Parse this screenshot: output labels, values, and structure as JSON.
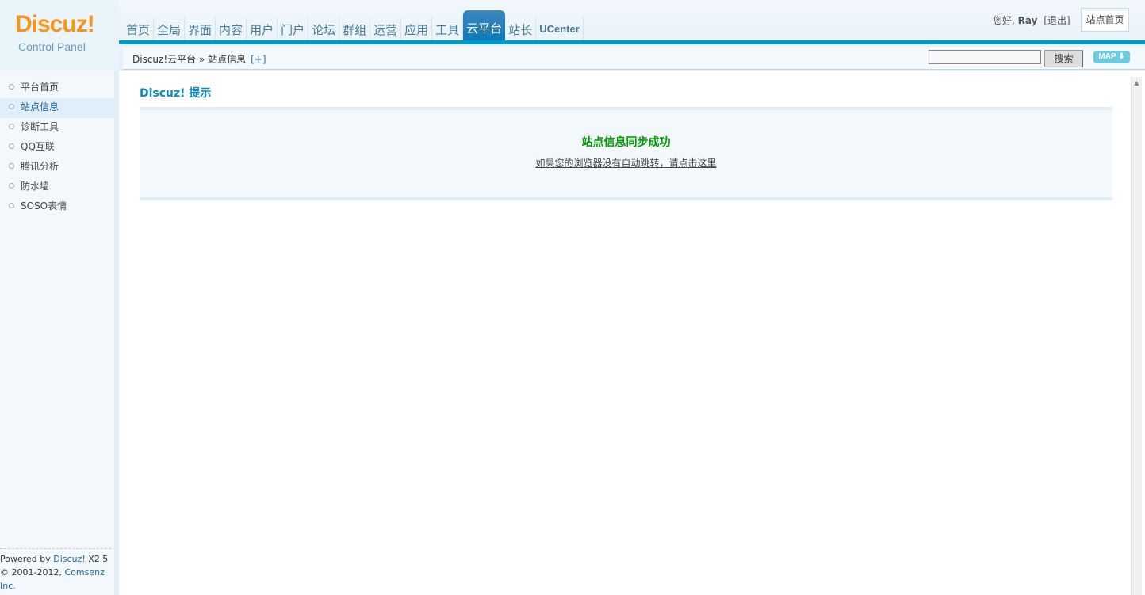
{
  "logo": {
    "brand": "Discuz!",
    "subtitle": "Control Panel"
  },
  "nav": [
    "首页",
    "全局",
    "界面",
    "内容",
    "用户",
    "门户",
    "论坛",
    "群组",
    "运营",
    "应用",
    "工具",
    "云平台",
    "站长",
    "UCenter"
  ],
  "nav_active": "云平台",
  "user": {
    "greeting": "您好,",
    "name": "Ray",
    "logout": "[退出]",
    "home": "站点首页"
  },
  "breadcrumb": {
    "path": "Discuz!云平台 » 站点信息",
    "add": "[+]"
  },
  "search": {
    "value": "",
    "button": "搜索",
    "map": "MAP ⬇"
  },
  "sidebar": {
    "items": [
      "平台首页",
      "站点信息",
      "诊断工具",
      "QQ互联",
      "腾讯分析",
      "防水墙",
      "SOSO表情"
    ],
    "active": 1
  },
  "footer": {
    "powered": "Powered by ",
    "discuz": "Discuz!",
    "version": " X2.5",
    "copy": "© 2001-2012, ",
    "company": "Comsenz Inc."
  },
  "main": {
    "title": "Discuz! 提示",
    "message": "站点信息同步成功",
    "redirect": "如果您的浏览器没有自动跳转，请点击这里"
  },
  "colors": {
    "accent": "#0099cc",
    "logo": "#f7941d",
    "success": "#009900"
  }
}
